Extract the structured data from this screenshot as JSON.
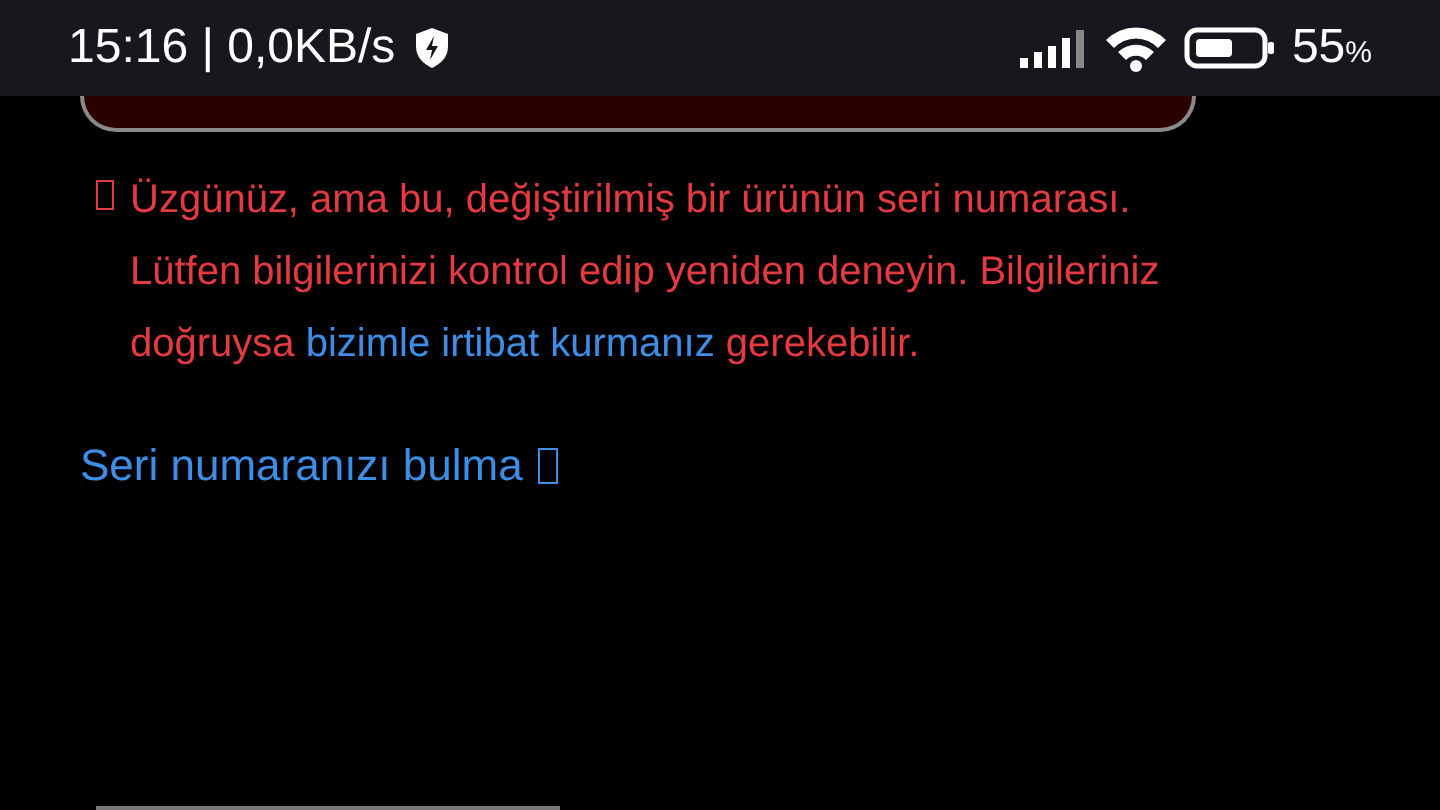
{
  "status_bar": {
    "time_speed": "15:16 | 0,0KB/s",
    "battery_percent": "55",
    "percent_sign": "%"
  },
  "error_message": {
    "text_before": "Üzgünüz, ama bu, değiştirilmiş bir ürünün seri numarası. Lütfen bilgilerinizi kontrol edip yeniden deneyin. Bilgileriniz doğruysa ",
    "link_parts": [
      "bizimle irtibat",
      "kurmanız"
    ],
    "text_after": " gerekebilir."
  },
  "help_link": {
    "label": "Seri numaranızı bulma"
  }
}
